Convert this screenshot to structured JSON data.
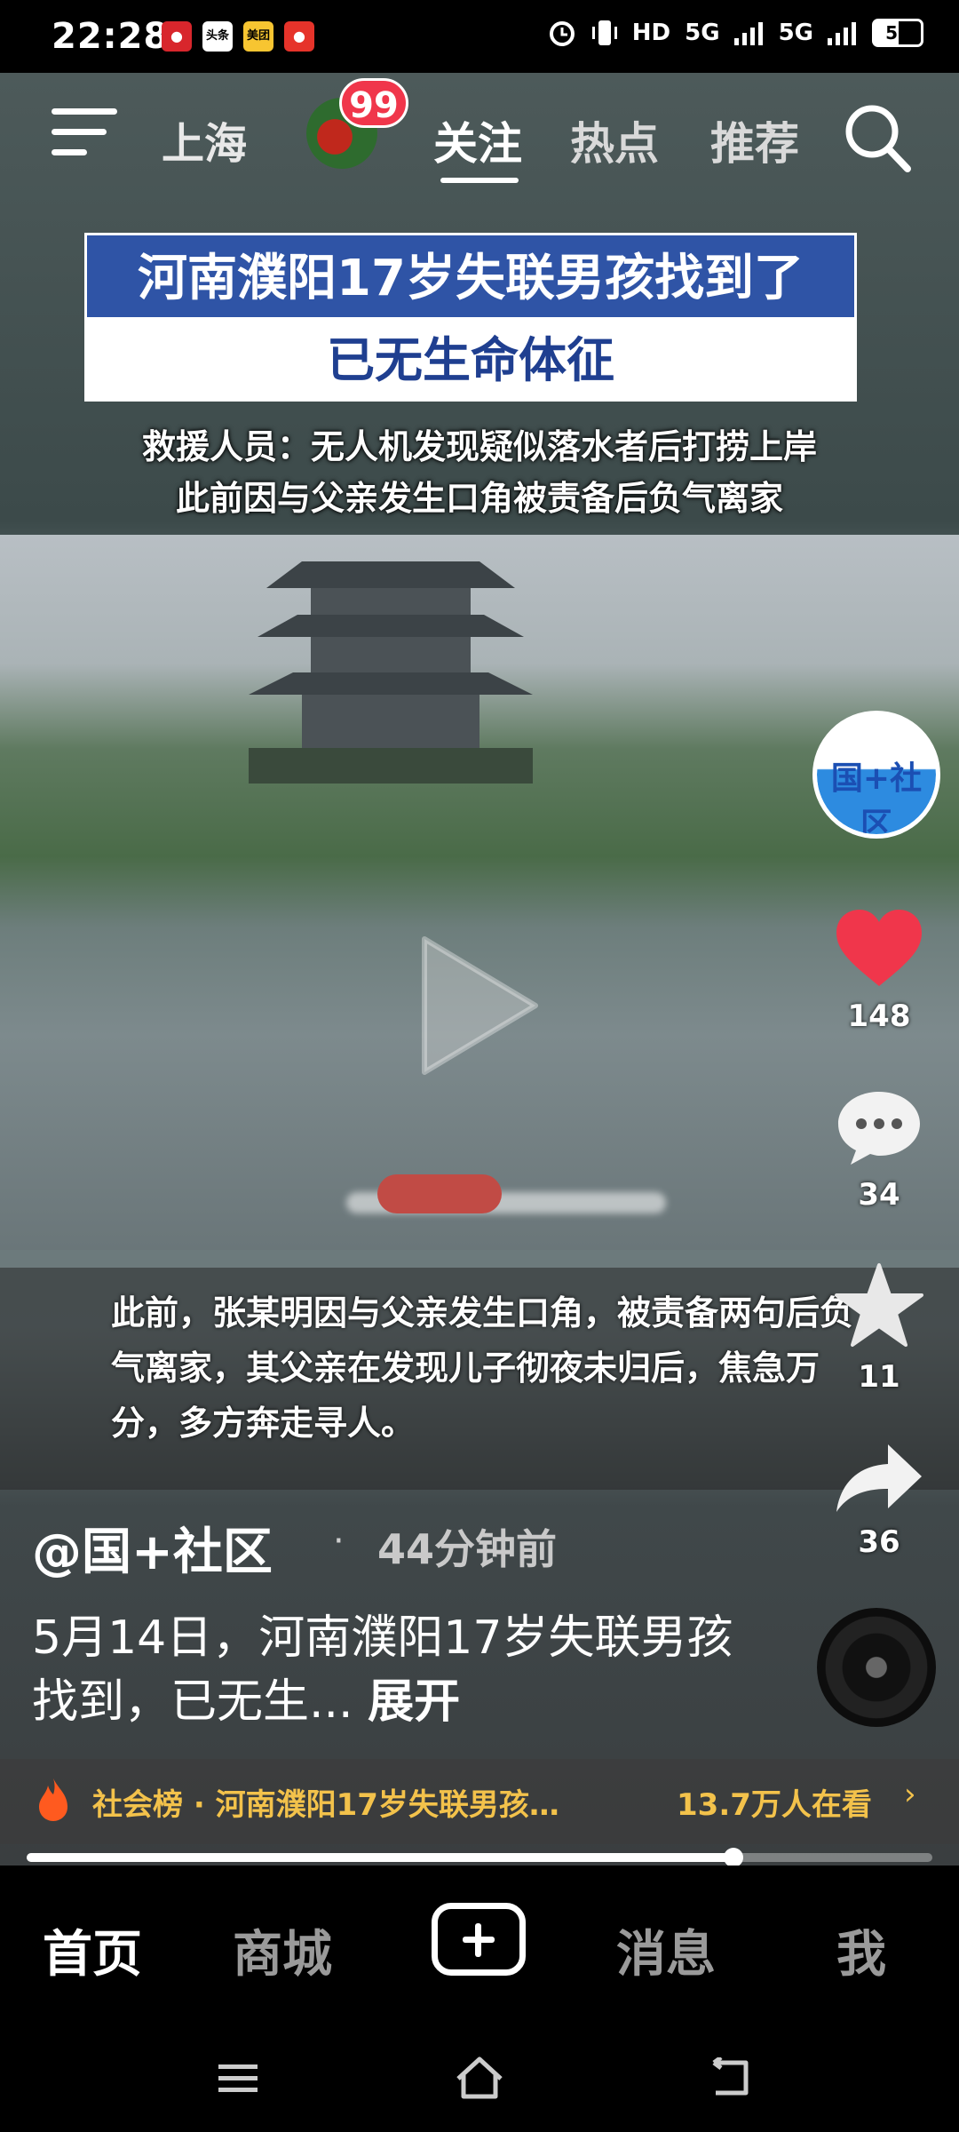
{
  "status_bar": {
    "time": "22:28",
    "notifications": [
      "app-red",
      "头条",
      "美团",
      "app-red-2"
    ],
    "network": [
      "HD",
      "5G",
      "5G"
    ],
    "battery": "51"
  },
  "top_nav": {
    "city": "上海",
    "badge_count": "99",
    "tabs": [
      "关注",
      "热点",
      "推荐"
    ],
    "active_tab": "关注"
  },
  "video": {
    "headline_line1": "河南濮阳17岁失联男孩找到了",
    "headline_line2": "已无生命体征",
    "sub_line1": "救援人员：无人机发现疑似落水者后打捞上岸",
    "sub_line2": "此前因与父亲发生口角被责备后负气离家",
    "caption": "此前，张某明因与父亲发生口角，被责备两句后负气离家，其父亲在发现儿子彻夜未归后，焦急万分，多方奔走寻人。",
    "progress": 0.78
  },
  "rail": {
    "channel_logo_text": "国+社区",
    "likes": "148",
    "comments": "34",
    "favorites": "11",
    "shares": "36"
  },
  "post": {
    "author": "@国+社区",
    "time_ago": "44分钟前",
    "description": "5月14日，河南濮阳17岁失联男孩找到，已无生...",
    "expand_label": "展开"
  },
  "hot": {
    "label": "社会榜 · 河南濮阳17岁失联男孩…",
    "viewers": "13.7万人在看",
    "chevron": "›"
  },
  "bottom_nav": {
    "items": [
      "首页",
      "商城",
      "消息",
      "我"
    ],
    "active": "首页"
  },
  "colors": {
    "accent_red": "#f0364b",
    "hot_yellow": "#f3c24b",
    "headline_blue": "#2f54a6"
  }
}
